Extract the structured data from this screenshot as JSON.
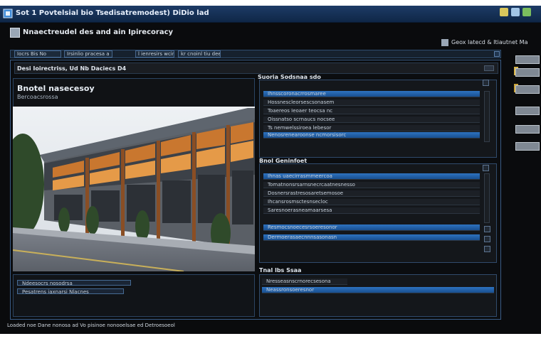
{
  "window": {
    "title": "Sot 1 Povtelsial bio Tsedisatremodest) DiDio lad",
    "controls": [
      "minimize",
      "maximize",
      "close"
    ]
  },
  "header": {
    "title": "Nnaectreudel des and ain Ipirecoracy",
    "right_label": "Geox Iatecd & Itiautnet Ma"
  },
  "toolbar": {
    "items": [
      "Iocrs Bis No",
      "Irsinlio pracesa a",
      "l ienresirs wcin",
      "kr cnoinl tiu dee"
    ]
  },
  "subbar": {
    "label": "Desi Ioirectriss, Ud Nb Daciecs D4"
  },
  "left_panel": {
    "title": "Bnotel nasecesoy",
    "subtitle": "Bercoacsrossa",
    "image": "building-photo"
  },
  "bottom_left": {
    "rows": [
      "Ndeesocrs nosodrsa",
      "Pesatrens iaxnarsi Nlacnes"
    ]
  },
  "panel1": {
    "header": "Suoria Sodsnaa sdo",
    "rows": [
      {
        "label": "Ihnsscoronacrrosmaree",
        "selected": true
      },
      {
        "label": "Hossnescleorsescsonasem",
        "selected": false
      },
      {
        "label": "Toaereos Ieoaer teocsa nc",
        "selected": false
      },
      {
        "label": "Oissnatso scrnaucs nocsee",
        "selected": false
      },
      {
        "label": "Ts nemwelssiroea lebesor",
        "selected": false
      },
      {
        "label": "Nenosrenearoonse ncmorsisorc",
        "selected": true
      }
    ]
  },
  "panel2": {
    "header": "Bnol Geninfoet",
    "rows": [
      {
        "label": "Ihnas uaecirrasmmeercoa",
        "selected": true
      },
      {
        "label": "Tomatnonsrsarnsnecrcaatnesnesso",
        "selected": false
      },
      {
        "label": "Dosnersrastresosaretsemosoe",
        "selected": false
      },
      {
        "label": "Ihcansrosmsctesnsecloc",
        "selected": false
      },
      {
        "label": "Saresnoerasneamaarsesa",
        "selected": false
      },
      {
        "label": "Resmocsnoecesrsoeresonor",
        "selected": true
      },
      {
        "label": "Dermoerasaecnnnsasonasn",
        "selected": true
      }
    ]
  },
  "panel3": {
    "header": "Tnal lbs Ssaa",
    "rows": [
      {
        "label": "Nresseasnscrnorecsesona",
        "selected": false
      },
      {
        "label": "Neassronsoeresnor",
        "selected": true
      }
    ]
  },
  "dock": {
    "items": [
      "dock-a",
      "dock-b",
      "dock-c",
      "dock-d",
      "dock-e",
      "dock-f"
    ]
  },
  "status": {
    "text": "Loaded noe Dane nonosa ad Vo pisinoe nonooelsae ed Detroesoeol"
  },
  "colors": {
    "accent": "#2e73c0",
    "titlebar": "#1d3b66",
    "frame": "#3a5c86"
  }
}
